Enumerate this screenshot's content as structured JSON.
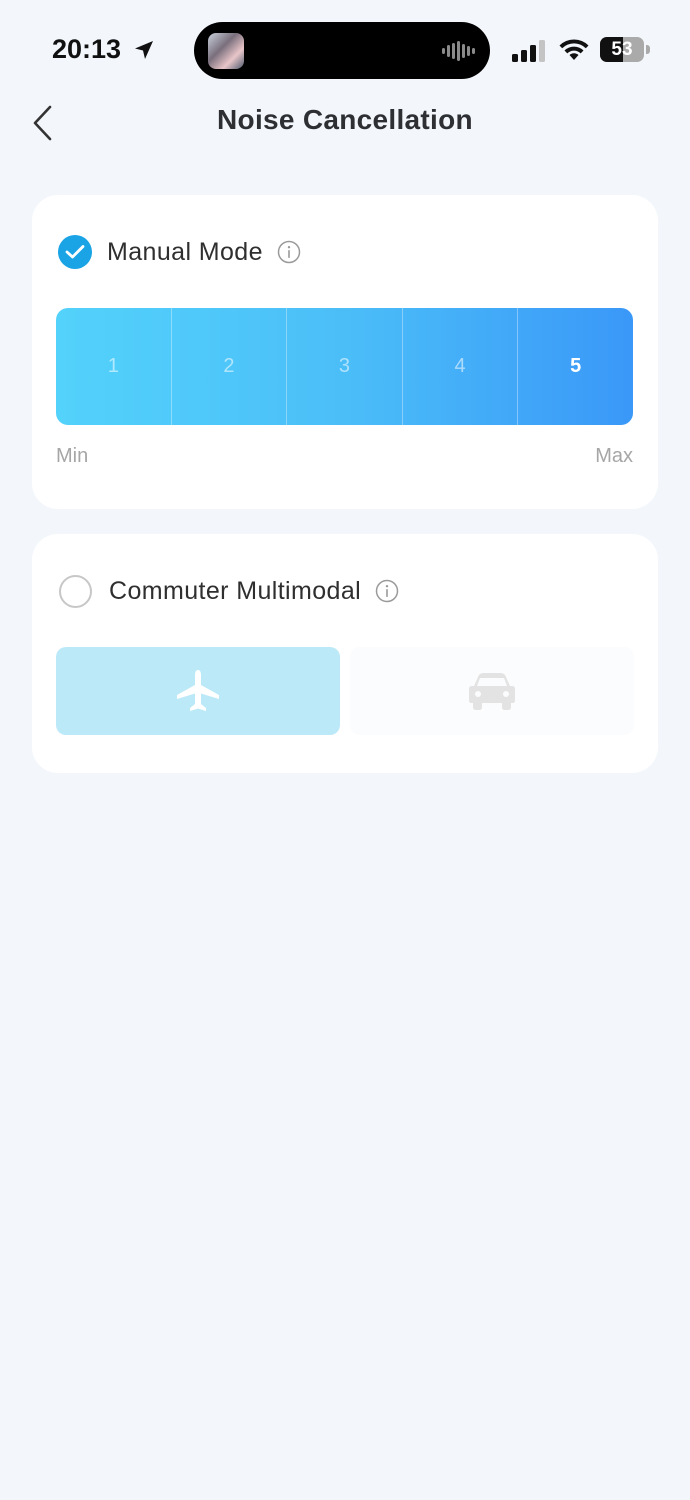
{
  "status_bar": {
    "time": "20:13",
    "battery": "53",
    "battery_level": 0.53,
    "icons": [
      "location-arrow-icon",
      "signal-icon",
      "wifi-icon",
      "battery-icon"
    ]
  },
  "header": {
    "title": "Noise Cancellation",
    "back_icon": "chevron-left-icon"
  },
  "manual_mode": {
    "label": "Manual Mode",
    "checked": true,
    "levels": [
      "1",
      "2",
      "3",
      "4",
      "5"
    ],
    "selected_level": "5",
    "min_label": "Min",
    "max_label": "Max"
  },
  "commuter_mode": {
    "label": "Commuter Multimodal",
    "checked": false,
    "options": [
      {
        "icon": "airplane-icon",
        "selected": true
      },
      {
        "icon": "car-icon",
        "selected": false
      }
    ]
  },
  "colors": {
    "accent": "#1aa4e6",
    "gradient_start": "#53d2fb",
    "gradient_end": "#3a98f8",
    "background": "#f3f7fb",
    "selected_option": "#bce9f8"
  }
}
